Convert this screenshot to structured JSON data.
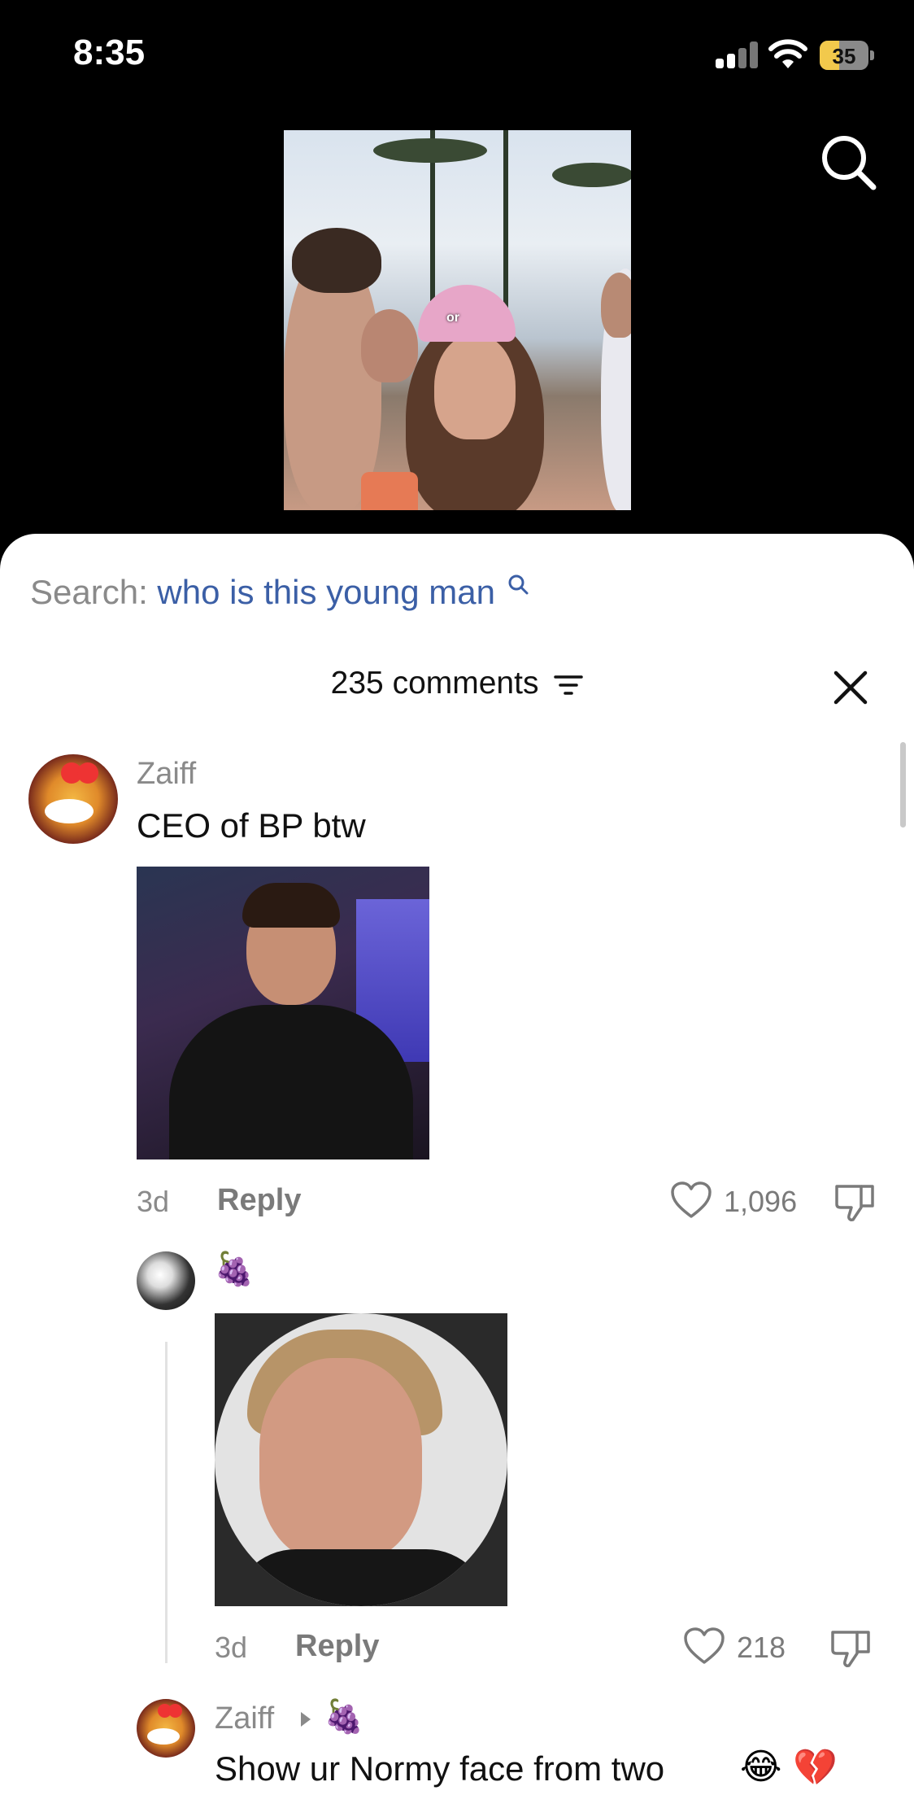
{
  "status_bar": {
    "time": "8:35",
    "battery": "35"
  },
  "video": {
    "caption": "or"
  },
  "sheet": {
    "search": {
      "prefix": "Search:",
      "query": "who is this young man"
    },
    "comments_count": "235 comments"
  },
  "comments": [
    {
      "username": "Zaiff",
      "text": "CEO of BP btw",
      "time": "3d",
      "reply_label": "Reply",
      "likes": "1,096"
    },
    {
      "username_emoji": "🍇",
      "time": "3d",
      "reply_label": "Reply",
      "likes": "218"
    },
    {
      "username": "Zaiff",
      "reply_to_emoji": "🍇",
      "text": "Show ur Normy face from two",
      "emojis": [
        "😂",
        "💔"
      ]
    }
  ],
  "colors": {
    "accent_link": "#3b5fa6",
    "muted_text": "#8a8a8a",
    "battery_fill": "#f2c94c"
  },
  "icons": [
    "signal-icon",
    "wifi-icon",
    "battery-icon",
    "search-icon",
    "filter-icon",
    "close-icon",
    "heart-icon",
    "dislike-icon"
  ]
}
